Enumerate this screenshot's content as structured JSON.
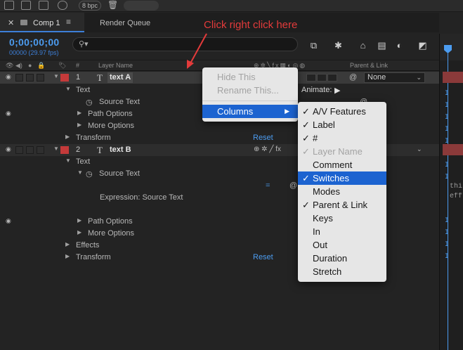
{
  "toolbar": {
    "bpc_label": "8 bpc"
  },
  "tabs": [
    {
      "label": "Comp 1",
      "active": true
    },
    {
      "label": "Render Queue",
      "active": false
    }
  ],
  "time": {
    "timecode": "0;00;00;00",
    "frames": "00000 (29.97 fps)"
  },
  "search": {
    "placeholder": ""
  },
  "columns": {
    "layer_name": "Layer Name",
    "number": "#",
    "parent_link": "Parent & Link"
  },
  "annotation": {
    "text": "Click right click here"
  },
  "layers": [
    {
      "number": "1",
      "name": "text A",
      "label_color": "#c43a3a",
      "parent": "None",
      "children": {
        "text": "Text",
        "animate": "Animate:",
        "source_text": "Source Text",
        "path_options": "Path Options",
        "more_options": "More Options",
        "transform": "Transform",
        "reset": "Reset"
      }
    },
    {
      "number": "2",
      "name": "text B",
      "label_color": "#c43a3a",
      "children": {
        "text": "Text",
        "source_text": "Source Text",
        "expression": "Expression: Source Text",
        "path_options": "Path Options",
        "more_options": "More Options",
        "effects": "Effects",
        "transform": "Transform",
        "reset": "Reset"
      }
    }
  ],
  "context_menu": {
    "items": [
      {
        "label": "Hide This",
        "enabled": false
      },
      {
        "label": "Rename This...",
        "enabled": false
      },
      {
        "label": "Columns",
        "enabled": true,
        "highlighted": true,
        "has_submenu": true
      }
    ]
  },
  "columns_submenu": {
    "items": [
      {
        "label": "A/V Features",
        "checked": true,
        "enabled": true
      },
      {
        "label": "Label",
        "checked": true,
        "enabled": true
      },
      {
        "label": "#",
        "checked": true,
        "enabled": true
      },
      {
        "label": "Layer Name",
        "checked": true,
        "enabled": false
      },
      {
        "label": "Comment",
        "checked": false,
        "enabled": true
      },
      {
        "label": "Switches",
        "checked": true,
        "enabled": true,
        "highlighted": true
      },
      {
        "label": "Modes",
        "checked": false,
        "enabled": true
      },
      {
        "label": "Parent & Link",
        "checked": true,
        "enabled": true
      },
      {
        "label": "Keys",
        "checked": false,
        "enabled": true
      },
      {
        "label": "In",
        "checked": false,
        "enabled": true
      },
      {
        "label": "Out",
        "checked": false,
        "enabled": true
      },
      {
        "label": "Duration",
        "checked": false,
        "enabled": true
      },
      {
        "label": "Stretch",
        "checked": false,
        "enabled": true
      }
    ],
    "checkmark": "✓"
  },
  "timeline": {
    "code_lines": [
      "thi",
      "eff"
    ]
  },
  "colors": {
    "accent_blue": "#4c9cf0",
    "menu_highlight": "#1c63d0",
    "label_red": "#c43a3a",
    "annotation_red": "#e33b3b"
  }
}
